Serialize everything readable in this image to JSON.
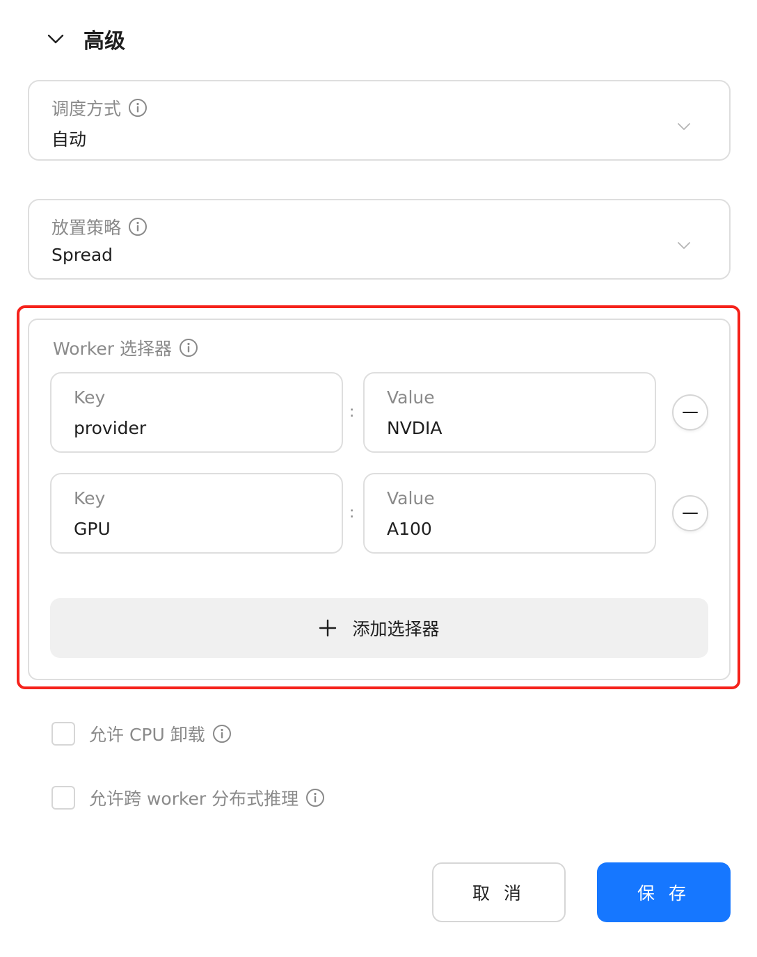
{
  "section": {
    "title": "高级",
    "expanded": true
  },
  "scheduling": {
    "label": "调度方式",
    "value": "自动"
  },
  "placement": {
    "label": "放置策略",
    "value": "Spread"
  },
  "worker_selector": {
    "label": "Worker 选择器",
    "rows": [
      {
        "key_label": "Key",
        "key_value": "provider",
        "separator": ":",
        "value_label": "Value",
        "value_value": "NVDIA"
      },
      {
        "key_label": "Key",
        "key_value": "GPU",
        "separator": ":",
        "value_label": "Value",
        "value_value": "A100"
      }
    ],
    "add_label": "添加选择器"
  },
  "options": {
    "cpu_offload": {
      "label": "允许 CPU 卸载",
      "checked": false
    },
    "distributed": {
      "label": "允许跨 worker 分布式推理",
      "checked": false
    }
  },
  "footer": {
    "cancel_label": "取 消",
    "save_label": "保 存"
  },
  "colors": {
    "accent": "#1677ff",
    "highlight": "#f5221b",
    "muted": "#8a8a8a",
    "border": "#dedede"
  },
  "icons": [
    "chevron-down-icon",
    "info-icon",
    "minus-icon",
    "plus-icon"
  ]
}
